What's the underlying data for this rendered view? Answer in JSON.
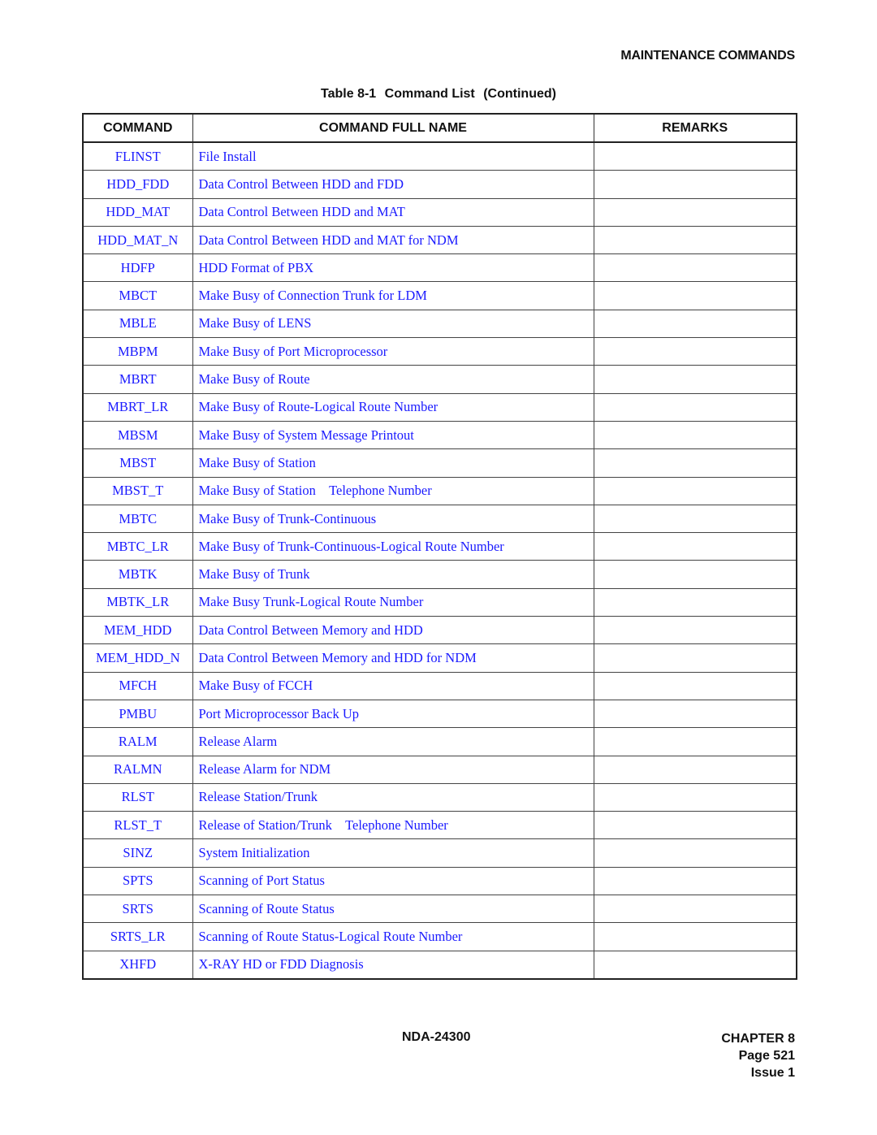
{
  "header": {
    "section_title": "MAINTENANCE COMMANDS"
  },
  "table": {
    "caption_number": "Table 8-1",
    "caption_title": "Command List",
    "caption_suffix": "(Continued)",
    "columns": [
      "COMMAND",
      "COMMAND FULL NAME",
      "REMARKS"
    ],
    "rows": [
      {
        "command": "FLINST",
        "full_name": "File Install",
        "remarks": ""
      },
      {
        "command": "HDD_FDD",
        "full_name": "Data Control Between HDD and FDD",
        "remarks": ""
      },
      {
        "command": "HDD_MAT",
        "full_name": "Data Control Between HDD and MAT",
        "remarks": ""
      },
      {
        "command": "HDD_MAT_N",
        "full_name": "Data Control Between HDD and MAT for NDM",
        "remarks": ""
      },
      {
        "command": "HDFP",
        "full_name": "HDD Format of PBX",
        "remarks": ""
      },
      {
        "command": "MBCT",
        "full_name": "Make Busy of Connection Trunk for LDM",
        "remarks": ""
      },
      {
        "command": "MBLE",
        "full_name": "Make Busy of LENS",
        "remarks": ""
      },
      {
        "command": "MBPM",
        "full_name": "Make Busy of Port Microprocessor",
        "remarks": ""
      },
      {
        "command": "MBRT",
        "full_name": "Make Busy of Route",
        "remarks": ""
      },
      {
        "command": "MBRT_LR",
        "full_name": "Make Busy of Route-Logical Route Number",
        "remarks": ""
      },
      {
        "command": "MBSM",
        "full_name": "Make Busy of System Message Printout",
        "remarks": ""
      },
      {
        "command": "MBST",
        "full_name": "Make Busy of Station",
        "remarks": ""
      },
      {
        "command": "MBST_T",
        "full_name": "Make Busy of Station    Telephone Number",
        "remarks": ""
      },
      {
        "command": "MBTC",
        "full_name": "Make Busy of Trunk-Continuous",
        "remarks": ""
      },
      {
        "command": "MBTC_LR",
        "full_name": "Make Busy of Trunk-Continuous-Logical Route Number",
        "remarks": ""
      },
      {
        "command": "MBTK",
        "full_name": "Make Busy of Trunk",
        "remarks": ""
      },
      {
        "command": "MBTK_LR",
        "full_name": "Make Busy Trunk-Logical Route Number",
        "remarks": ""
      },
      {
        "command": "MEM_HDD",
        "full_name": "Data Control Between Memory and HDD",
        "remarks": ""
      },
      {
        "command": "MEM_HDD_N",
        "full_name": "Data Control Between Memory and HDD for NDM",
        "remarks": ""
      },
      {
        "command": "MFCH",
        "full_name": "Make Busy of FCCH",
        "remarks": ""
      },
      {
        "command": "PMBU",
        "full_name": "Port Microprocessor Back Up",
        "remarks": ""
      },
      {
        "command": "RALM",
        "full_name": "Release Alarm",
        "remarks": ""
      },
      {
        "command": "RALMN",
        "full_name": "Release Alarm for NDM",
        "remarks": ""
      },
      {
        "command": "RLST",
        "full_name": "Release Station/Trunk",
        "remarks": ""
      },
      {
        "command": "RLST_T",
        "full_name": "Release of Station/Trunk    Telephone Number",
        "remarks": ""
      },
      {
        "command": "SINZ",
        "full_name": "System Initialization",
        "remarks": ""
      },
      {
        "command": "SPTS",
        "full_name": "Scanning of Port Status",
        "remarks": ""
      },
      {
        "command": "SRTS",
        "full_name": "Scanning of Route Status",
        "remarks": ""
      },
      {
        "command": "SRTS_LR",
        "full_name": "Scanning of Route Status-Logical Route Number",
        "remarks": ""
      },
      {
        "command": "XHFD",
        "full_name": "X-RAY HD or FDD Diagnosis",
        "remarks": ""
      }
    ]
  },
  "footer": {
    "document_number": "NDA-24300",
    "chapter": "CHAPTER 8",
    "page": "Page 521",
    "issue": "Issue 1"
  },
  "colors": {
    "link_text": "#1a1aff",
    "heading_text": "#111111"
  }
}
